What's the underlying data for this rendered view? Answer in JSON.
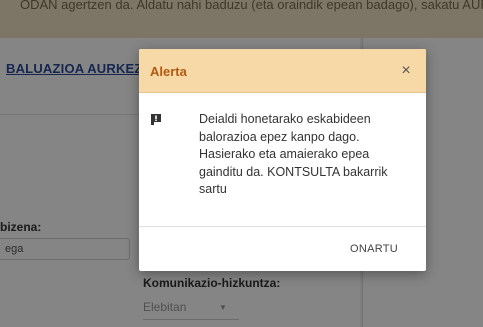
{
  "background": {
    "banner_text": "ODAN agertzen da. Aldatu nahi baduzu (eta oraindik epean badago), sakatu AURREZ",
    "section_title": "BALUAZIOA AURKEZTU",
    "field1_label": "bizena:",
    "field1_value": "ega",
    "field2_label": "Komunikazio-hizkuntza:",
    "field2_value": "Elebitan"
  },
  "modal": {
    "title": "Alerta",
    "close_symbol": "×",
    "message": "Deialdi honetarako eskabideen balorazioa epez kanpo dago. Hasierako eta amaierako epea gainditu da. KONTSULTA bakarrik sartu",
    "message_icon": "flag-icon",
    "ok_label": "ONARTU"
  },
  "colors": {
    "header_bg": "#f6d9a6",
    "title_color": "#b35a12",
    "link_blue": "#2a4c9c"
  }
}
